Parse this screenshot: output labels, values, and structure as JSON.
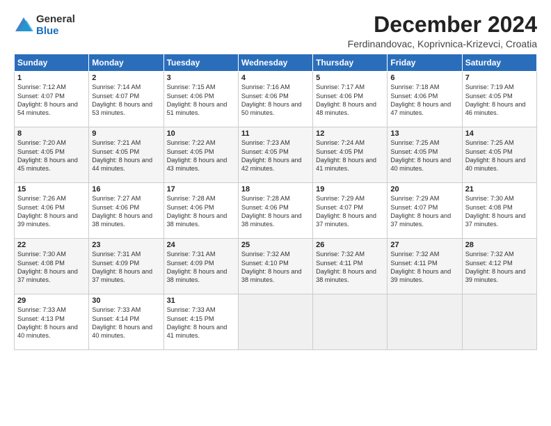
{
  "logo": {
    "general": "General",
    "blue": "Blue"
  },
  "title": "December 2024",
  "location": "Ferdinandovac, Koprivnica-Krizevci, Croatia",
  "days_header": [
    "Sunday",
    "Monday",
    "Tuesday",
    "Wednesday",
    "Thursday",
    "Friday",
    "Saturday"
  ],
  "weeks": [
    [
      {
        "day": "1",
        "sunrise": "7:12 AM",
        "sunset": "4:07 PM",
        "daylight": "8 hours and 54 minutes."
      },
      {
        "day": "2",
        "sunrise": "7:14 AM",
        "sunset": "4:07 PM",
        "daylight": "8 hours and 53 minutes."
      },
      {
        "day": "3",
        "sunrise": "7:15 AM",
        "sunset": "4:06 PM",
        "daylight": "8 hours and 51 minutes."
      },
      {
        "day": "4",
        "sunrise": "7:16 AM",
        "sunset": "4:06 PM",
        "daylight": "8 hours and 50 minutes."
      },
      {
        "day": "5",
        "sunrise": "7:17 AM",
        "sunset": "4:06 PM",
        "daylight": "8 hours and 48 minutes."
      },
      {
        "day": "6",
        "sunrise": "7:18 AM",
        "sunset": "4:06 PM",
        "daylight": "8 hours and 47 minutes."
      },
      {
        "day": "7",
        "sunrise": "7:19 AM",
        "sunset": "4:05 PM",
        "daylight": "8 hours and 46 minutes."
      }
    ],
    [
      {
        "day": "8",
        "sunrise": "7:20 AM",
        "sunset": "4:05 PM",
        "daylight": "8 hours and 45 minutes."
      },
      {
        "day": "9",
        "sunrise": "7:21 AM",
        "sunset": "4:05 PM",
        "daylight": "8 hours and 44 minutes."
      },
      {
        "day": "10",
        "sunrise": "7:22 AM",
        "sunset": "4:05 PM",
        "daylight": "8 hours and 43 minutes."
      },
      {
        "day": "11",
        "sunrise": "7:23 AM",
        "sunset": "4:05 PM",
        "daylight": "8 hours and 42 minutes."
      },
      {
        "day": "12",
        "sunrise": "7:24 AM",
        "sunset": "4:05 PM",
        "daylight": "8 hours and 41 minutes."
      },
      {
        "day": "13",
        "sunrise": "7:25 AM",
        "sunset": "4:05 PM",
        "daylight": "8 hours and 40 minutes."
      },
      {
        "day": "14",
        "sunrise": "7:25 AM",
        "sunset": "4:05 PM",
        "daylight": "8 hours and 40 minutes."
      }
    ],
    [
      {
        "day": "15",
        "sunrise": "7:26 AM",
        "sunset": "4:06 PM",
        "daylight": "8 hours and 39 minutes."
      },
      {
        "day": "16",
        "sunrise": "7:27 AM",
        "sunset": "4:06 PM",
        "daylight": "8 hours and 38 minutes."
      },
      {
        "day": "17",
        "sunrise": "7:28 AM",
        "sunset": "4:06 PM",
        "daylight": "8 hours and 38 minutes."
      },
      {
        "day": "18",
        "sunrise": "7:28 AM",
        "sunset": "4:06 PM",
        "daylight": "8 hours and 38 minutes."
      },
      {
        "day": "19",
        "sunrise": "7:29 AM",
        "sunset": "4:07 PM",
        "daylight": "8 hours and 37 minutes."
      },
      {
        "day": "20",
        "sunrise": "7:29 AM",
        "sunset": "4:07 PM",
        "daylight": "8 hours and 37 minutes."
      },
      {
        "day": "21",
        "sunrise": "7:30 AM",
        "sunset": "4:08 PM",
        "daylight": "8 hours and 37 minutes."
      }
    ],
    [
      {
        "day": "22",
        "sunrise": "7:30 AM",
        "sunset": "4:08 PM",
        "daylight": "8 hours and 37 minutes."
      },
      {
        "day": "23",
        "sunrise": "7:31 AM",
        "sunset": "4:09 PM",
        "daylight": "8 hours and 37 minutes."
      },
      {
        "day": "24",
        "sunrise": "7:31 AM",
        "sunset": "4:09 PM",
        "daylight": "8 hours and 38 minutes."
      },
      {
        "day": "25",
        "sunrise": "7:32 AM",
        "sunset": "4:10 PM",
        "daylight": "8 hours and 38 minutes."
      },
      {
        "day": "26",
        "sunrise": "7:32 AM",
        "sunset": "4:11 PM",
        "daylight": "8 hours and 38 minutes."
      },
      {
        "day": "27",
        "sunrise": "7:32 AM",
        "sunset": "4:11 PM",
        "daylight": "8 hours and 39 minutes."
      },
      {
        "day": "28",
        "sunrise": "7:32 AM",
        "sunset": "4:12 PM",
        "daylight": "8 hours and 39 minutes."
      }
    ],
    [
      {
        "day": "29",
        "sunrise": "7:33 AM",
        "sunset": "4:13 PM",
        "daylight": "8 hours and 40 minutes."
      },
      {
        "day": "30",
        "sunrise": "7:33 AM",
        "sunset": "4:14 PM",
        "daylight": "8 hours and 40 minutes."
      },
      {
        "day": "31",
        "sunrise": "7:33 AM",
        "sunset": "4:15 PM",
        "daylight": "8 hours and 41 minutes."
      },
      null,
      null,
      null,
      null
    ]
  ],
  "labels": {
    "sunrise": "Sunrise:",
    "sunset": "Sunset:",
    "daylight": "Daylight:"
  }
}
